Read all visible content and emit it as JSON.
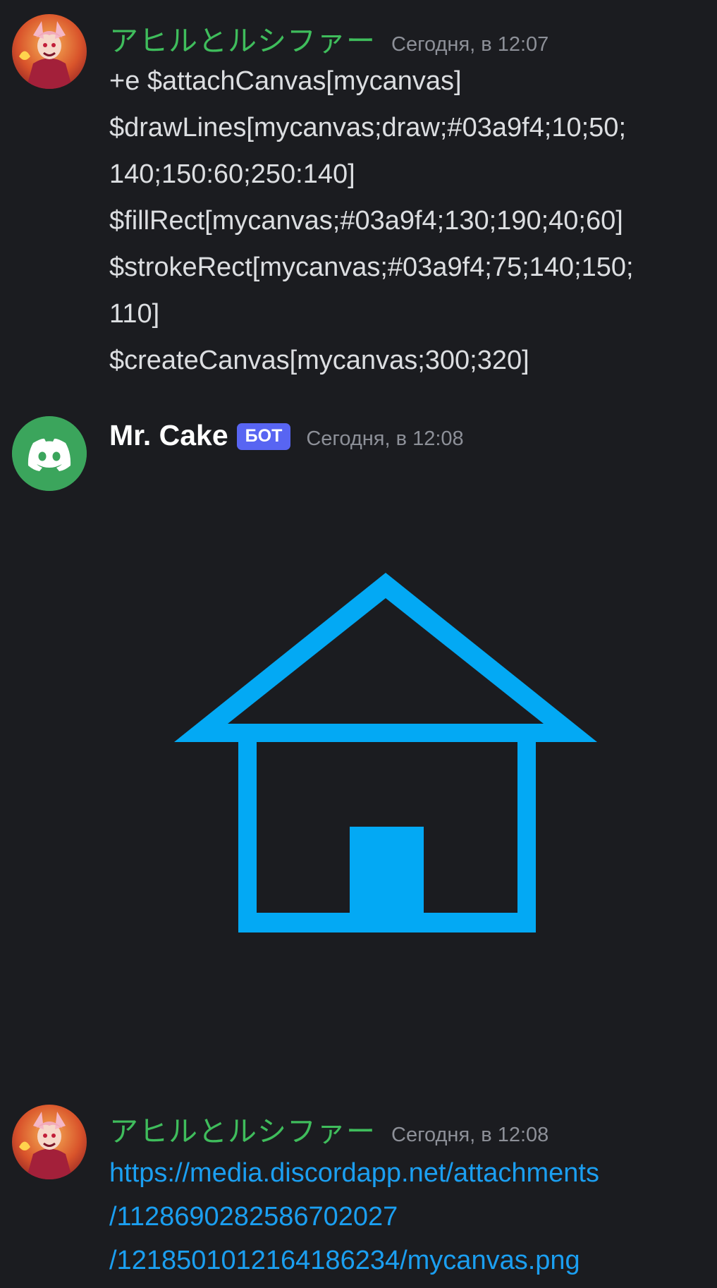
{
  "messages": [
    {
      "username": "アヒルとルシファー",
      "timestamp": "Сегодня, в 12:07",
      "lines": [
        "+e $attachCanvas[mycanvas]",
        "$drawLines[mycanvas;draw;#03a9f4;10;50;",
        "140;150:60;250:140]",
        "$fillRect[mycanvas;#03a9f4;130;190;40;60]",
        "$strokeRect[mycanvas;#03a9f4;75;140;150;",
        "110]",
        "$createCanvas[mycanvas;300;320]"
      ]
    },
    {
      "username": "Mr. Cake",
      "badge": "БОТ",
      "timestamp": "Сегодня, в 12:08",
      "attachment_icon": "house-canvas-image",
      "accent_color": "#03a9f4"
    },
    {
      "username": "アヒルとルシファー",
      "timestamp": "Сегодня, в 12:08",
      "link_lines": [
        "https://media.discordapp.net/attachments",
        "/1128690282586702027",
        "/1218501012164186234/mycanvas.png"
      ]
    }
  ],
  "colors": {
    "background": "#1b1c20",
    "username_green": "#3fbd5c",
    "timestamp": "#8d9098",
    "bot_badge": "#5865f2",
    "link": "#1b9ff1",
    "discord_avatar_bg": "#3ba55c"
  }
}
